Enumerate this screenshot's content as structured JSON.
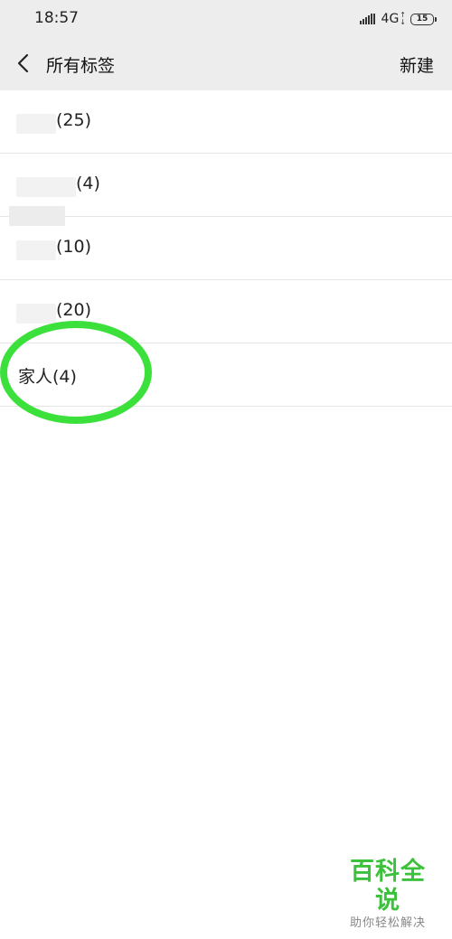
{
  "status_bar": {
    "time": "18:57",
    "network": "4G",
    "battery": "15"
  },
  "header": {
    "title": "所有标签",
    "new_button": "新建"
  },
  "tags": [
    {
      "label": "(25)"
    },
    {
      "label": "(4)"
    },
    {
      "label": "(10)"
    },
    {
      "label": "(20)"
    },
    {
      "label": "家人(4)"
    }
  ],
  "annotation": {
    "color": "#3be03b"
  },
  "watermark": {
    "logo": "百科全说",
    "slogan": "助你轻松解决",
    "color": "#3cc13c"
  }
}
